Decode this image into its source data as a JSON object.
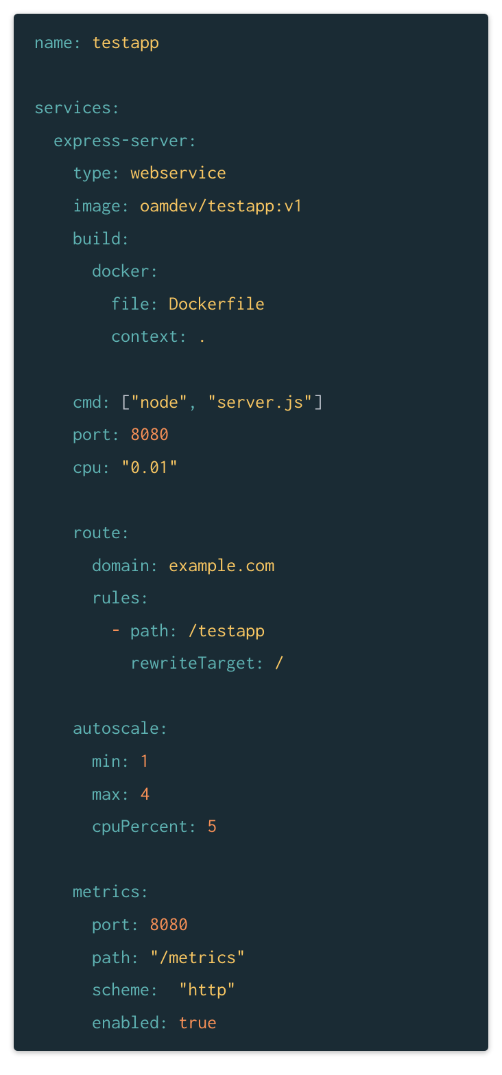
{
  "yaml": {
    "name_key": "name",
    "name_val": "testapp",
    "services_key": "services",
    "express_key": "express-server",
    "type_key": "type",
    "type_val": "webservice",
    "image_key": "image",
    "image_val": "oamdev/testapp:v1",
    "build_key": "build",
    "docker_key": "docker",
    "file_key": "file",
    "file_val": "Dockerfile",
    "context_key": "context",
    "context_val": ".",
    "cmd_key": "cmd",
    "cmd_val1": "\"node\"",
    "cmd_val2": "\"server.js\"",
    "cmd_open": "[",
    "cmd_close": "]",
    "cmd_comma": ", ",
    "port_key": "port",
    "port_val": "8080",
    "cpu_key": "cpu",
    "cpu_val": "\"0.01\"",
    "route_key": "route",
    "domain_key": "domain",
    "domain_val": "example.com",
    "rules_key": "rules",
    "path_key": "path",
    "path_val": "/testapp",
    "rewrite_key": "rewriteTarget",
    "rewrite_val": "/",
    "autoscale_key": "autoscale",
    "min_key": "min",
    "min_val": "1",
    "max_key": "max",
    "max_val": "4",
    "cpupercent_key": "cpuPercent",
    "cpupercent_val": "5",
    "metrics_key": "metrics",
    "mport_key": "port",
    "mport_val": "8080",
    "mpath_key": "path",
    "mpath_val": "\"/metrics\"",
    "scheme_key": "scheme",
    "scheme_val": "\"http\"",
    "enabled_key": "enabled",
    "enabled_val": "true",
    "colon": ":",
    "dash": "- "
  }
}
